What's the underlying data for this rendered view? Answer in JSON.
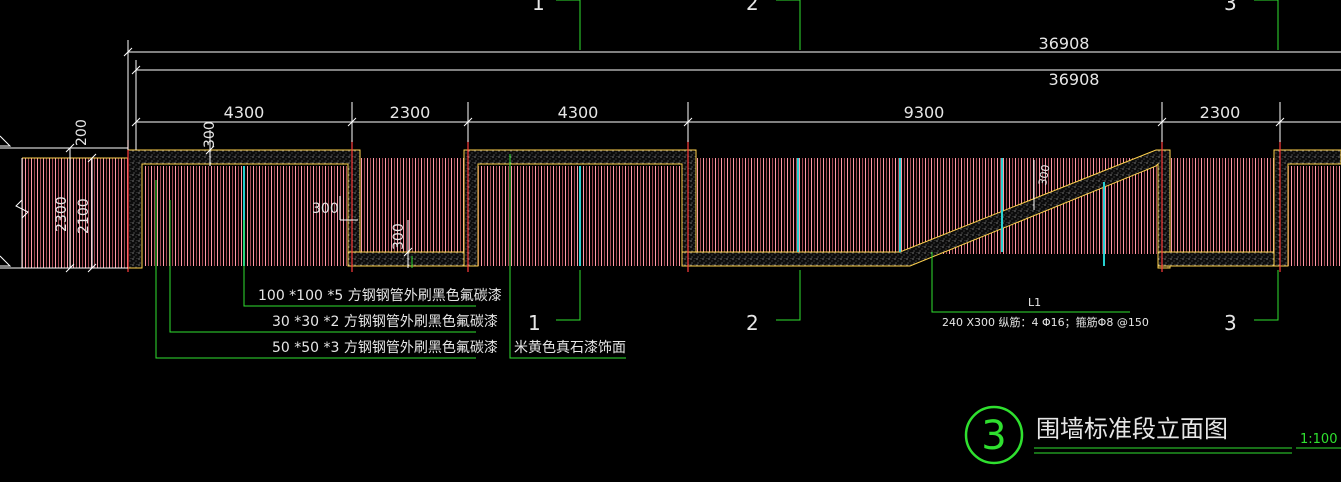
{
  "dimensions": {
    "total_upper": "36908",
    "total_lower": "36908",
    "segments": [
      "4300",
      "2300",
      "4300",
      "9300",
      "2300"
    ],
    "left_vertical": [
      "200",
      "2300",
      "2100"
    ],
    "top_300": "300",
    "side_300": "300",
    "low_300": "300",
    "beam_300": "300"
  },
  "axes": {
    "top": [
      "1",
      "2",
      "3"
    ],
    "bottom": [
      "1",
      "2",
      "3"
    ]
  },
  "callouts": {
    "pipe_100": "100 *100 *5 方钢钢管外刷黑色氟碳漆",
    "pipe_30": "30 *30 *2 方钢钢管外刷黑色氟碳漆",
    "pipe_50": "50 *50 *3 方钢钢管外刷黑色氟碳漆",
    "stone_finish": "米黄色真石漆饰面",
    "beam_mark": "L1",
    "beam_spec": "240 X300  纵筋：4 Φ16；箍筋Φ8 @150"
  },
  "title": {
    "number": "3",
    "text": "围墙标准段立面图",
    "scale": "1:100"
  },
  "colors": {
    "background": "#000000",
    "dim_line": "#ffffff",
    "leader": "#2fe02f",
    "fence_bar": "#ff9aa8",
    "concrete_edge": "#ffd24d",
    "cyan_post": "#27d1d1",
    "red_tick": "#ff3b3b",
    "text": "#e6e6e6"
  }
}
